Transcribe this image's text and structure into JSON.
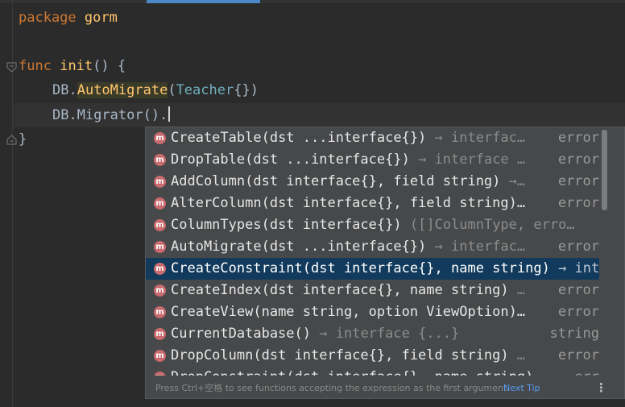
{
  "editor": {
    "line1": {
      "kw": "package",
      "name": "gorm"
    },
    "line3": {
      "kw": "func",
      "name": "init",
      "rest": "() {"
    },
    "line4": {
      "obj": "DB.",
      "method": "AutoMigrate",
      "open": "(",
      "type": "Teacher",
      "close": "{})"
    },
    "line5": {
      "text": "DB.Migrator()."
    },
    "line6": {
      "text": "}"
    }
  },
  "completion": {
    "items": [
      {
        "name": "CreateTable",
        "params": "(dst ...interface{})",
        "tail": "→ interfac…",
        "type": "error",
        "selected": false
      },
      {
        "name": "DropTable",
        "params": "(dst ...interface{})",
        "tail": "→ interface …",
        "type": "error",
        "selected": false
      },
      {
        "name": "AddColumn",
        "params": "(dst interface{}, field string)",
        "tail": "→…",
        "type": "error",
        "selected": false
      },
      {
        "name": "AlterColumn",
        "params": "(dst interface{}, field string)…",
        "tail": "",
        "type": "error",
        "selected": false
      },
      {
        "name": "ColumnTypes",
        "params": "(dst interface{})",
        "tail": "  ([]ColumnType, erro…",
        "type": "",
        "selected": false
      },
      {
        "name": "AutoMigrate",
        "params": "(dst ...interface{})",
        "tail": "→ interfac…",
        "type": "error",
        "selected": false
      },
      {
        "name": "CreateConstraint",
        "params": "(dst interface{}, name string)",
        "tail": "→ inter",
        "type": "",
        "selected": true
      },
      {
        "name": "CreateIndex",
        "params": "(dst interface{}, name string)",
        "tail": "…",
        "type": "error",
        "selected": false
      },
      {
        "name": "CreateView",
        "params": "(name string, option ViewOption)…",
        "tail": "",
        "type": "error",
        "selected": false
      },
      {
        "name": "CurrentDatabase",
        "params": "()",
        "tail": "→ interface {...}",
        "type": "string",
        "selected": false
      },
      {
        "name": "DropColumn",
        "params": "(dst interface{}, field string)",
        "tail": "…",
        "type": "error",
        "selected": false
      },
      {
        "name": "DropConstraint",
        "params": "(dst interface{}, name string)",
        "tail": "",
        "type": "err",
        "selected": false
      }
    ],
    "footer": {
      "tip": "Press Ctrl+空格 to see functions accepting the expression as the first argument",
      "next_tip": "Next Tip",
      "more": "⋮"
    }
  }
}
